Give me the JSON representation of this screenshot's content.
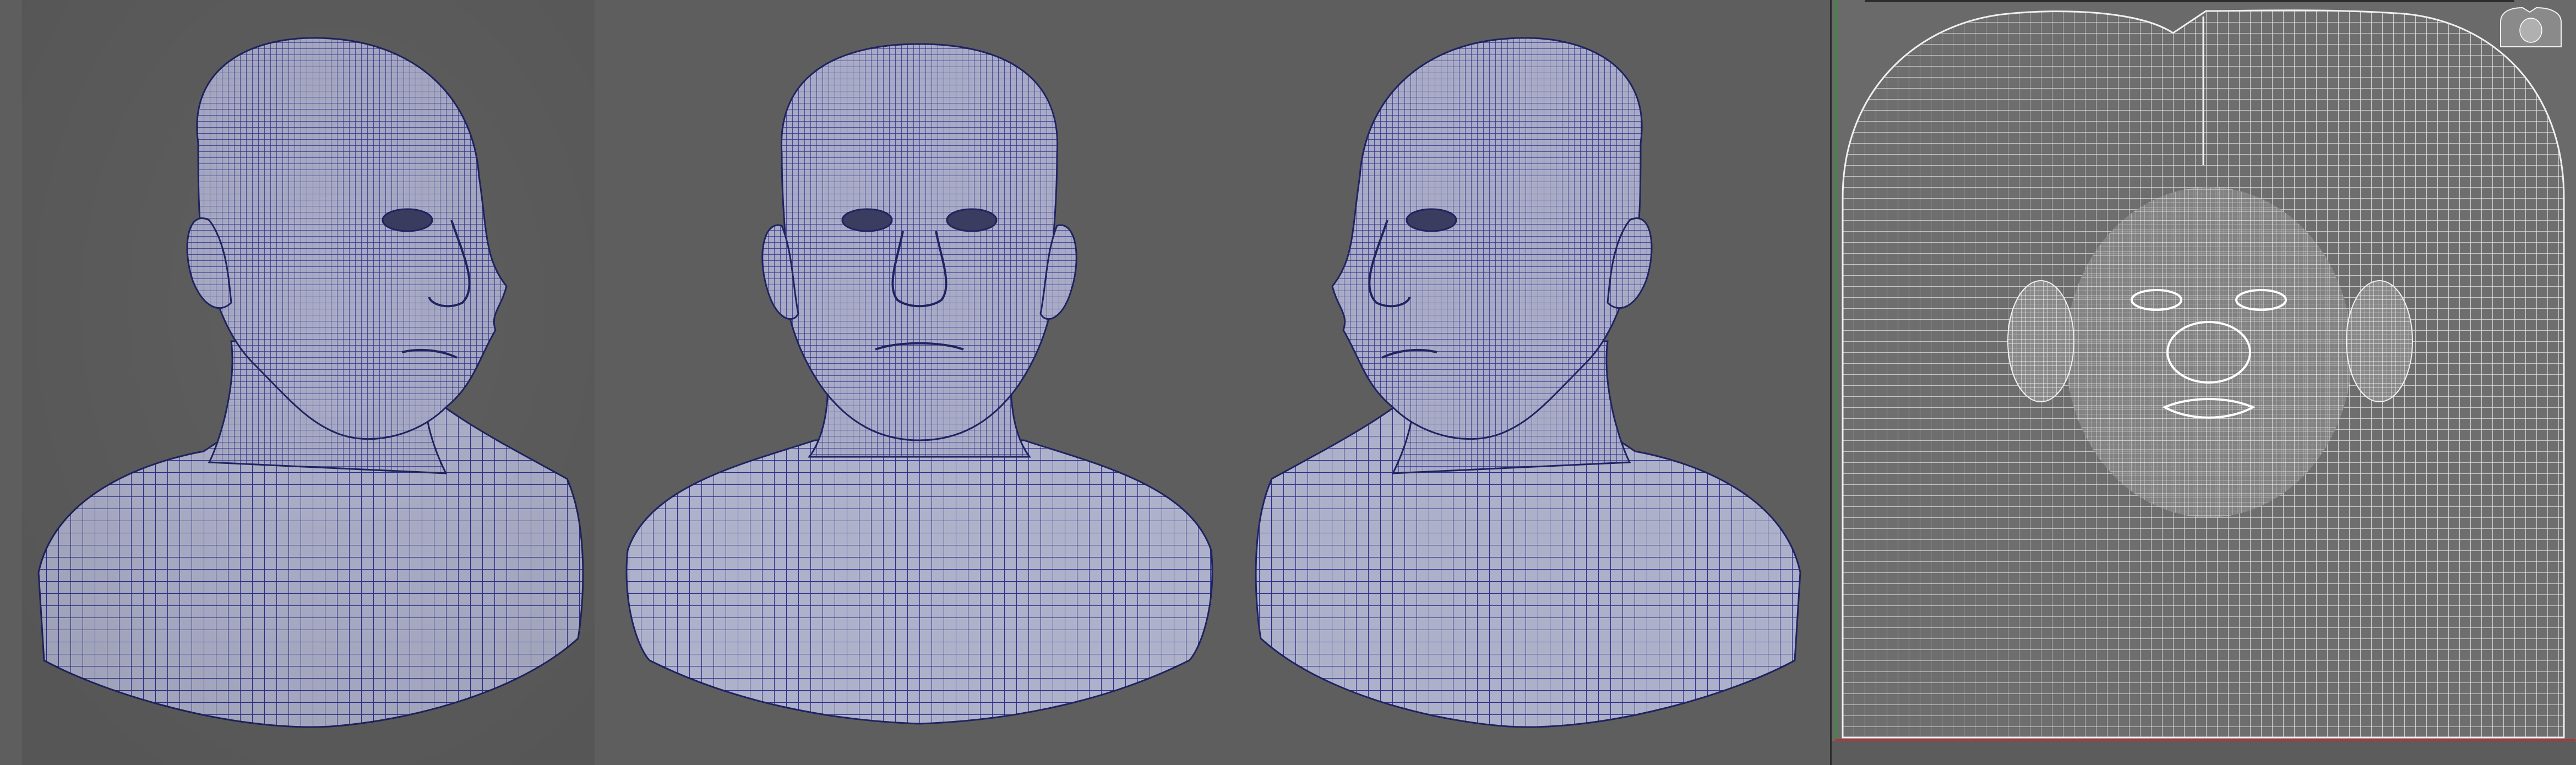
{
  "scene": {
    "viewport_background": "#5e5e5e",
    "uv_background": "#6a6a6a",
    "mesh_fill": "#aeb0c8",
    "wire_color": "#2b2f8a",
    "uv_wire_color": "#e6e6e6",
    "axis_v_color": "#3c8c3c",
    "axis_h_color": "#a83a3a"
  },
  "views": [
    {
      "name": "three-quarter-left",
      "facing": "right"
    },
    {
      "name": "front",
      "facing": "front"
    },
    {
      "name": "three-quarter-right",
      "facing": "left"
    }
  ]
}
